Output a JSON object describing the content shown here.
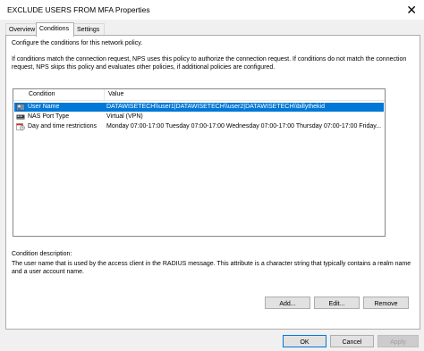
{
  "window": {
    "title": "EXCLUDE USERS FROM MFA Properties",
    "close_glyph": "✕"
  },
  "tabs": [
    {
      "label": "Overview",
      "active": false
    },
    {
      "label": "Conditions",
      "active": true
    },
    {
      "label": "Settings",
      "active": false
    }
  ],
  "panel": {
    "intro": "Configure the conditions for this network policy.",
    "explain_line1": "If conditions match the connection request, NPS uses this policy to authorize the connection request. If conditions do not match the connection",
    "explain_line2": "request, NPS skips this policy and evaluates other policies, if additional policies are configured."
  },
  "conditions_list": {
    "columns": [
      "Condition",
      "Value"
    ],
    "rows": [
      {
        "icon": "user-icon",
        "condition": "User Name",
        "value": "DATAWISETECH\\\\user1|DATAWISETECH\\\\user2|DATAWISETECH\\\\billythekid",
        "selected": true
      },
      {
        "icon": "network-port-icon",
        "condition": "NAS Port Type",
        "value": "Virtual (VPN)",
        "selected": false
      },
      {
        "icon": "clock-calendar-icon",
        "condition": "Day and time restrictions",
        "value": "Monday 07:00-17:00 Tuesday 07:00-17:00 Wednesday 07:00-17:00 Thursday 07:00-17:00 Friday...",
        "selected": false
      }
    ]
  },
  "description": {
    "label": "Condition description:",
    "line1": "The user name that is used by the access client in the RADIUS message. This attribute is a character string that typically contains a realm name",
    "line2": "and a user account name."
  },
  "actions": {
    "add": "Add...",
    "edit": "Edit...",
    "remove": "Remove"
  },
  "footer": {
    "ok": "OK",
    "cancel": "Cancel",
    "apply": "Apply"
  },
  "colors": {
    "selection": "#0078d7",
    "window_bg": "#f0f0f0"
  }
}
